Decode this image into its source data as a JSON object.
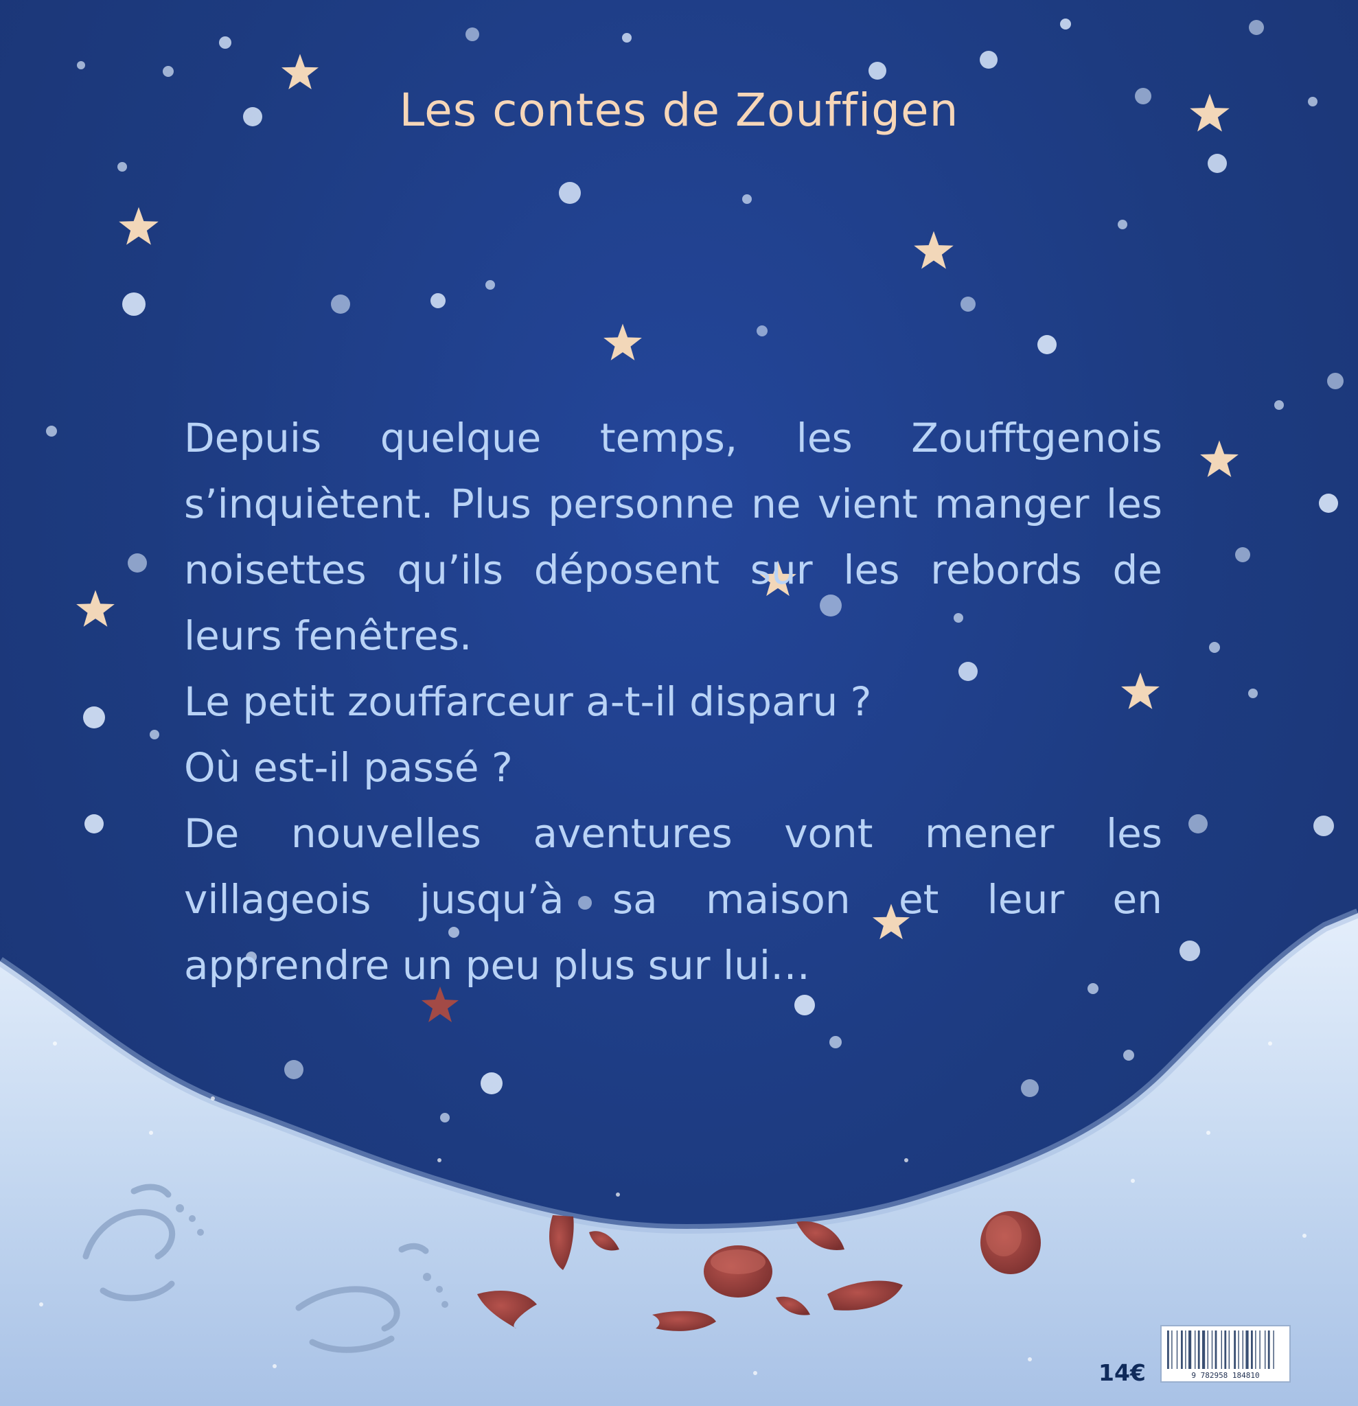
{
  "cover": {
    "title": "Les contes de Zouffigen",
    "blurb": [
      "Depuis quelque temps, les Zoufftgenois s’inquiètent. Plus personne ne vient manger les noisettes qu’ils déposent sur les rebords de leurs fenêtres.",
      "Le petit zouffarceur a-t-il disparu ?",
      "Où est-il passé ?",
      "De nouvelles aventures vont mener les villageois jusqu’à sa maison et leur en apprendre un peu plus sur lui…"
    ],
    "price": "14€",
    "barcode_digits": "9 782958 184810"
  },
  "colors": {
    "sky": "#1f3d84",
    "snow": "#cfe0f4",
    "star": "#f2d7b9",
    "title": "#f6d6b8",
    "blurb_text": "#b9d3f6",
    "nutshell": "#8f3b3a"
  },
  "icons": [
    "star-icon",
    "snowflake-icon",
    "nutshell-icon",
    "footprint-icon",
    "barcode-icon"
  ]
}
